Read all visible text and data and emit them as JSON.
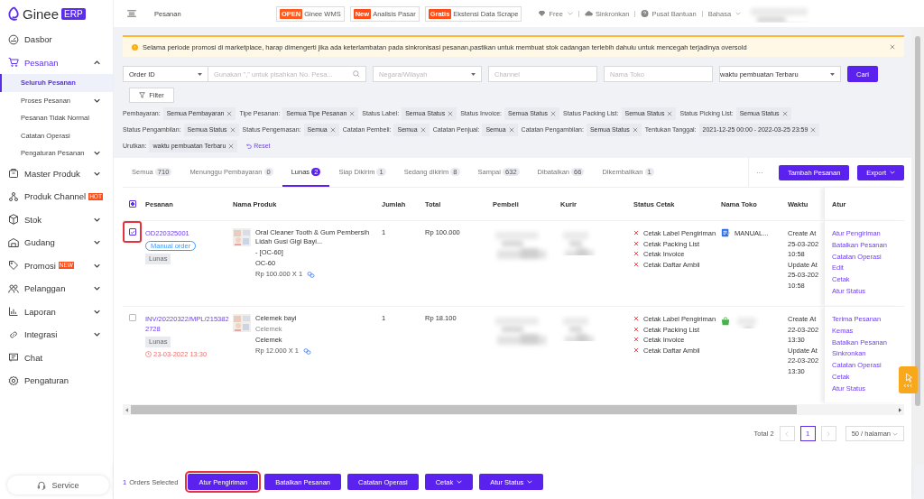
{
  "brand": {
    "name": "Ginee",
    "badge": "ERP"
  },
  "header": {
    "breadcrumb": "Pesanan",
    "promos": [
      {
        "badge": "OPEN",
        "label": "Ginee WMS"
      },
      {
        "badge": "New",
        "label": "Analisis Pasar"
      },
      {
        "badge": "Gratis",
        "label": "Ekstensi Data Scrape"
      }
    ],
    "links": [
      {
        "kind": "plan",
        "label": "Free"
      },
      {
        "kind": "sync",
        "label": "Sinkronkan"
      },
      {
        "kind": "help",
        "label": "Pusat Bantuan"
      },
      {
        "kind": "language",
        "label": "Bahasa"
      }
    ],
    "user": {
      "kind": "blurred"
    }
  },
  "sidebar": {
    "items": [
      {
        "label": "Dasbor",
        "selected": false
      },
      {
        "label": "Pesanan",
        "selected": true,
        "expanded": true,
        "children": [
          {
            "label": "Seluruh Pesanan",
            "selected": true
          },
          {
            "label": "Proses Pesanan",
            "selected": false,
            "expanded": false
          },
          {
            "label": "Pesanan Tidak Normal",
            "selected": false
          },
          {
            "label": "Catatan Operasi",
            "selected": false
          },
          {
            "label": "Pengaturan Pesanan",
            "selected": false,
            "expanded": false
          }
        ]
      },
      {
        "label": "Master Produk",
        "selected": false,
        "expanded": false
      },
      {
        "label": "Produk Channel",
        "selected": false,
        "expanded": false,
        "badge": "HOT"
      },
      {
        "label": "Stok",
        "selected": false,
        "expanded": false
      },
      {
        "label": "Gudang",
        "selected": false,
        "expanded": false
      },
      {
        "label": "Promosi",
        "selected": false,
        "expanded": false,
        "badge": "NEW"
      },
      {
        "label": "Pelanggan",
        "selected": false,
        "expanded": false
      },
      {
        "label": "Laporan",
        "selected": false,
        "expanded": false
      },
      {
        "label": "Integrasi",
        "selected": false,
        "expanded": false
      },
      {
        "label": "Chat",
        "selected": false
      },
      {
        "label": "Pengaturan",
        "selected": false
      }
    ],
    "service": "Service"
  },
  "notice": "Selama periode promosi di marketplace, harap dimengerti jika ada keterlambatan pada sinkronisasi pesanan,pastikan untuk membuat stok cadangan terlebih dahulu untuk mencegah terjadinya oversold",
  "search": {
    "field": "Order ID",
    "placeholder": "Gunakan \",\" untuk pisahkan No. Pesa...",
    "region_placeholder": "Negara/Wilayah",
    "channel_placeholder": "Channel",
    "store_placeholder": "Nama Toko",
    "sort": "waktu pembuatan Terbaru",
    "button": "Cari",
    "filter_button": "Filter"
  },
  "filters": [
    {
      "label": "Pembayaran:",
      "value": "Semua Pembayaran"
    },
    {
      "label": "Tipe Pesanan:",
      "value": "Semua Tipe Pesanan"
    },
    {
      "label": "Status Label:",
      "value": "Semua Status"
    },
    {
      "label": "Status Invoice:",
      "value": "Semua Status"
    },
    {
      "label": "Status Packing List:",
      "value": "Semua Status"
    },
    {
      "label": "Status Picking List:",
      "value": "Semua Status"
    },
    {
      "label": "Status Pengambilan:",
      "value": "Semua Status"
    },
    {
      "label": "Status Pengemasan:",
      "value": "Semua"
    },
    {
      "label": "Catatan Pembeli:",
      "value": "Semua"
    },
    {
      "label": "Catatan Penjual:",
      "value": "Semua"
    },
    {
      "label": "Catatan Pengambilan:",
      "value": "Semua Status"
    },
    {
      "label": "Tentukan Tanggal:",
      "value": "2021-12-25 00:00 - 2022-03-25 23:59"
    },
    {
      "label": "Urutkan:",
      "value": "waktu pembuatan Terbaru"
    }
  ],
  "reset": "Reset",
  "tabs": [
    {
      "label": "Semua",
      "count": "710",
      "selected": false
    },
    {
      "label": "Menunggu Pembayaran",
      "count": "0",
      "selected": false
    },
    {
      "label": "Lunas",
      "count": "2",
      "selected": true
    },
    {
      "label": "Siap Dikirim",
      "count": "1",
      "selected": false
    },
    {
      "label": "Sedang dikirim",
      "count": "8",
      "selected": false
    },
    {
      "label": "Sampai",
      "count": "632",
      "selected": false
    },
    {
      "label": "Dibatalkan",
      "count": "66",
      "selected": false
    },
    {
      "label": "Dikembalikan",
      "count": "1",
      "selected": false
    }
  ],
  "more": "···",
  "actions": [
    {
      "label": "Tambah Pesanan",
      "dropdown": false
    },
    {
      "label": "Export",
      "dropdown": true
    }
  ],
  "table": {
    "select_all": {
      "partial": true
    },
    "columns": [
      "Pesanan",
      "Nama Produk",
      "Jumlah",
      "Total",
      "Pembeli",
      "Kurir",
      "Status Cetak",
      "Nama Toko",
      "Waktu",
      "Atur"
    ],
    "rows": [
      {
        "checked": true,
        "highlighted": true,
        "order": "OD220325001",
        "tag": "Manual order",
        "status": "Lunas",
        "product": {
          "kind": "picture",
          "name": "Oral Cleaner Tooth & Gum Pembersih Lidah Gusi Gigi Bayi...",
          "variant": "- [OC-60]",
          "sku": "OC-60",
          "price": "Rp 100.000 X 1"
        },
        "quantity": "1",
        "total": "Rp 100.000",
        "buyer": {
          "kind": "blurred"
        },
        "courier": {
          "kind": "blurred"
        },
        "print_status": [
          {
            "label": "Cetak Label Pengiriman",
            "printed": false
          },
          {
            "label": "Cetak Packing List",
            "printed": false
          },
          {
            "label": "Cetak Invoice",
            "printed": false
          },
          {
            "label": "Cetak Daftar Ambil",
            "printed": false
          }
        ],
        "store": {
          "kind": "manual",
          "name": "MANUAL..."
        },
        "time": [
          "Create At",
          "25-03-202",
          "10:58",
          "Update At",
          "25-03-202",
          "10:58"
        ],
        "links": [
          "Atur Pengiriman",
          "Batalkan Pesanan",
          "Catatan Operasi",
          "Edit",
          "Cetak",
          "Atur Status"
        ]
      },
      {
        "checked": false,
        "highlighted": false,
        "order": "INV/20220322/MPL/2153822728",
        "status": "Lunas",
        "deadline": "23-03-2022 13:30",
        "product": {
          "kind": "picture",
          "name": "Celemek bayi",
          "variant": "Celemek",
          "sku": "Celemek",
          "price": "Rp 12.000 X 1"
        },
        "quantity": "1",
        "total": "Rp 18.100",
        "buyer": {
          "kind": "blurred"
        },
        "courier": {
          "kind": "blurred"
        },
        "print_status": [
          {
            "label": "Cetak Label Pengiriman",
            "printed": false
          },
          {
            "label": "Cetak Packing List",
            "printed": false
          },
          {
            "label": "Cetak Invoice",
            "printed": false
          },
          {
            "label": "Cetak Daftar Ambil",
            "printed": false
          }
        ],
        "store": {
          "kind": "shop"
        },
        "time": [
          "Create At",
          "22-03-202",
          "13:30",
          "Update At",
          "22-03-202",
          "13:30"
        ],
        "links": [
          "Terima Pesanan",
          "Kemas",
          "Batalkan Pesanan",
          "Sinkronkan",
          "Catatan Operasi",
          "Cetak",
          "Atur Status"
        ]
      }
    ]
  },
  "pagination": {
    "total": "Total 2",
    "pages": [
      {
        "label": "1",
        "selected": true
      }
    ],
    "page_size": "50 / halaman"
  },
  "bulk_bar": {
    "count": "1",
    "label": "Orders Selected",
    "buttons": [
      {
        "label": "Atur Pengiriman",
        "dropdown": false,
        "highlighted": true
      },
      {
        "label": "Batalkan Pesanan",
        "dropdown": false,
        "highlighted": false
      },
      {
        "label": "Catatan Operasi",
        "dropdown": false,
        "highlighted": false
      },
      {
        "label": "Cetak",
        "dropdown": true,
        "highlighted": false
      },
      {
        "label": "Atur Status",
        "dropdown": true,
        "highlighted": false
      }
    ]
  }
}
